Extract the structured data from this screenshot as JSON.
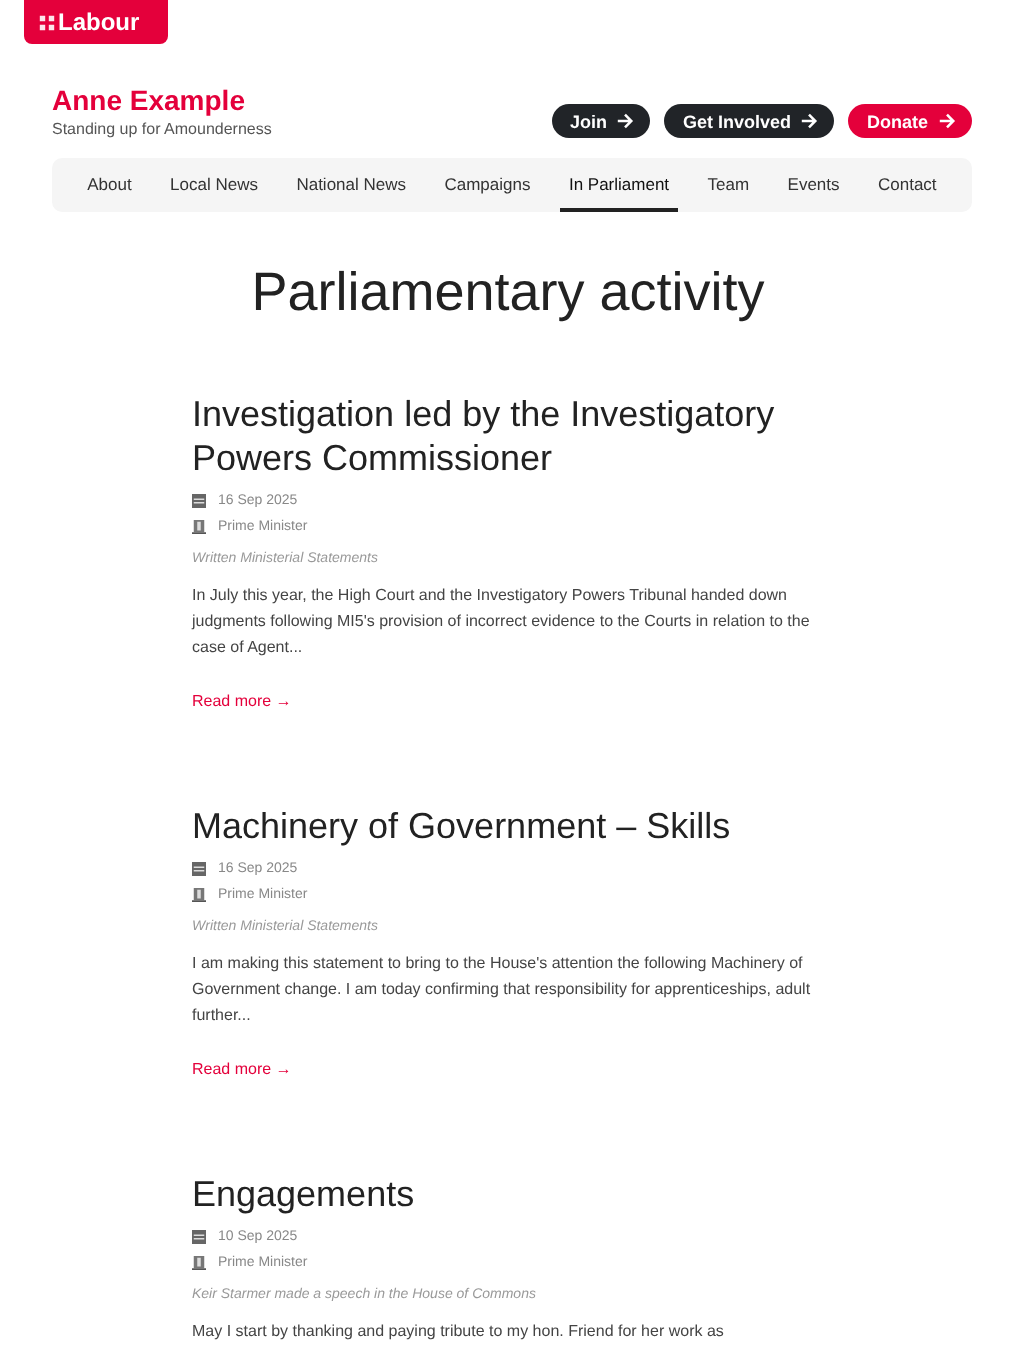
{
  "logo": {
    "text": "Labour"
  },
  "site": {
    "name": "Anne Example",
    "tagline": "Standing up for Amounderness"
  },
  "actions": [
    {
      "label": "Join",
      "kind": "dark"
    },
    {
      "label": "Get Involved",
      "kind": "dark"
    },
    {
      "label": "Donate",
      "kind": "accent"
    }
  ],
  "nav": [
    {
      "label": "About",
      "selected": false
    },
    {
      "label": "Local News",
      "selected": false
    },
    {
      "label": "National News",
      "selected": false
    },
    {
      "label": "Campaigns",
      "selected": false
    },
    {
      "label": "In Parliament",
      "selected": true
    },
    {
      "label": "Team",
      "selected": false
    },
    {
      "label": "Events",
      "selected": false
    },
    {
      "label": "Contact",
      "selected": false
    }
  ],
  "page_title": "Parliamentary activity",
  "articles": [
    {
      "title": "Investigation led by the Investigatory Powers Commissioner",
      "date": "16 Sep 2025",
      "author": "Prime Minister",
      "category": "Written Ministerial Statements",
      "excerpt": "In July this year, the High Court and the Investigatory Powers Tribunal handed down judgments following MI5's provision of incorrect evidence to the Courts in relation to the case of Agent...",
      "link": "Read more →"
    },
    {
      "title": "Machinery of Government – Skills",
      "date": "16 Sep 2025",
      "author": "Prime Minister",
      "category": "Written Ministerial Statements",
      "excerpt": "I am making this statement to bring to the House's attention the following Machinery of Government change. I am today confirming that responsibility for apprenticeships, adult further...",
      "link": "Read more →"
    },
    {
      "title": "Engagements",
      "date": "10 Sep 2025",
      "author": "Prime Minister",
      "category": "Keir Starmer made a speech in the House of Commons",
      "excerpt": "May I start by thanking and paying tribute to my hon. Friend for her work as"
    }
  ]
}
